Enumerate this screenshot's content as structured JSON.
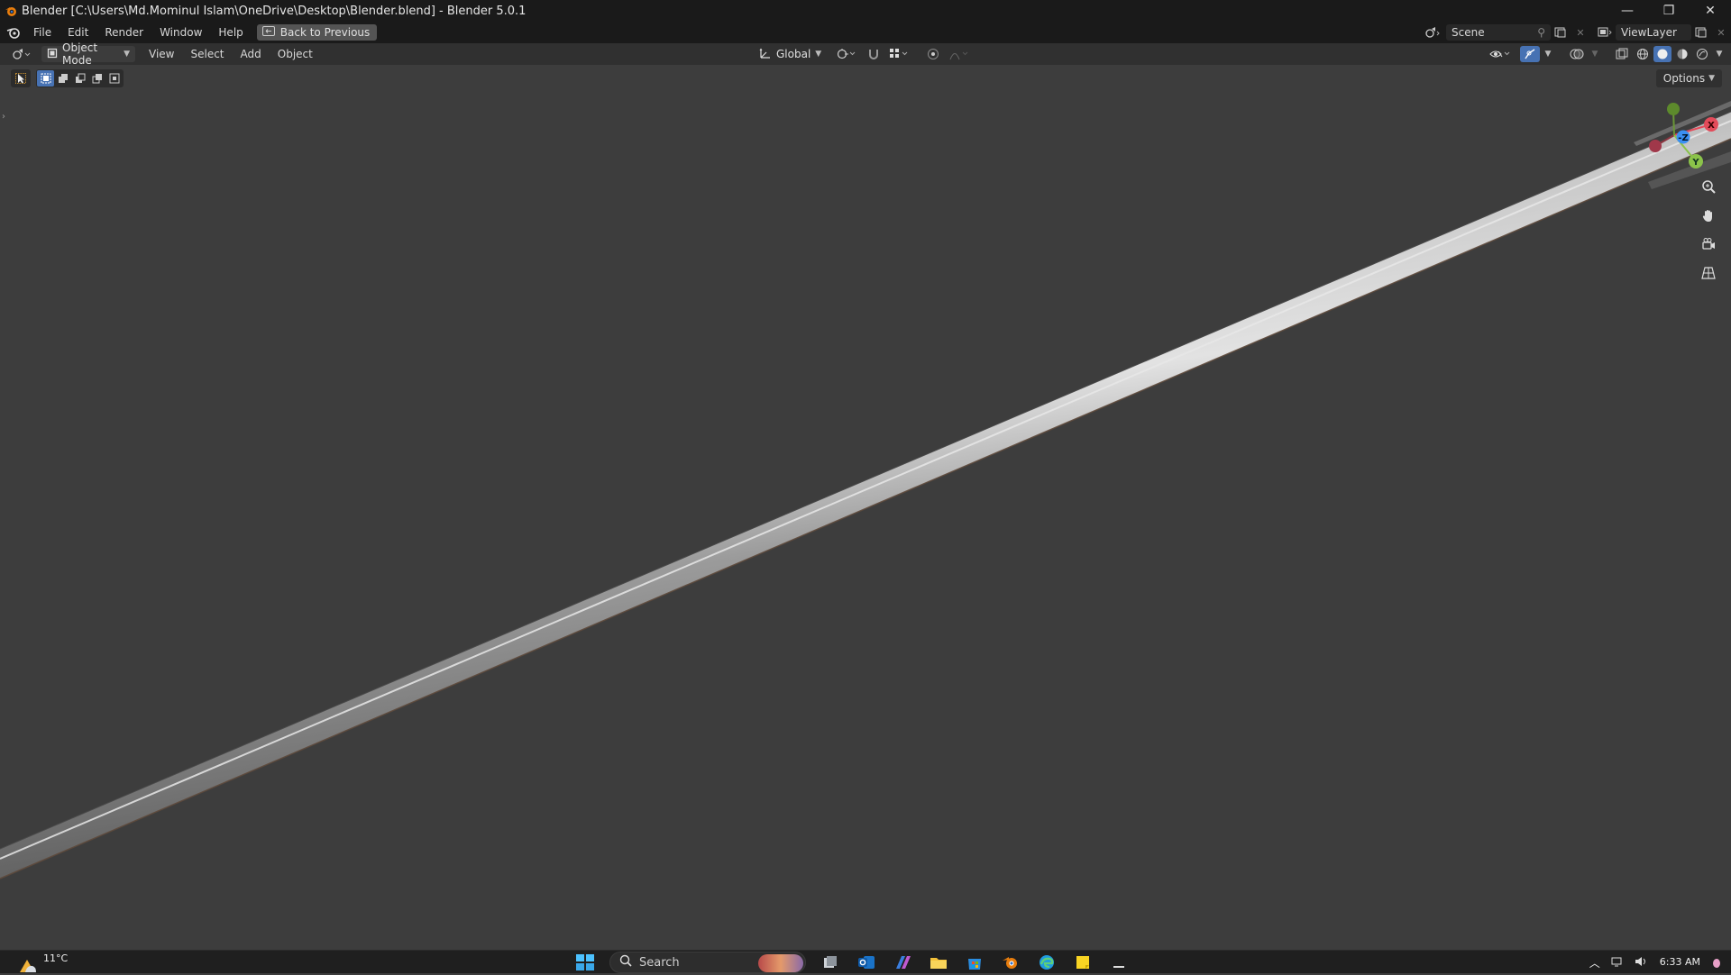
{
  "window": {
    "title": "Blender [C:\\Users\\Md.Mominul Islam\\OneDrive\\Desktop\\Blender.blend] - Blender 5.0.1",
    "controls": [
      "—",
      "❐",
      "✕"
    ]
  },
  "menubar": {
    "items": [
      "File",
      "Edit",
      "Render",
      "Window",
      "Help"
    ],
    "back_button": "Back to Previous",
    "scene": "Scene",
    "view_layer": "ViewLayer"
  },
  "header3d": {
    "mode": "Object Mode",
    "menus": [
      "View",
      "Select",
      "Add",
      "Object"
    ],
    "transform_orientation": "Global",
    "options_label": "Options"
  },
  "viewport": {
    "background_color": "#3d3d3d",
    "object_color": "#9a9a9a"
  },
  "gizmo": {
    "x_label": "X",
    "y_label": "Y",
    "z_label": "Z",
    "x_color": "#e34b5a",
    "y_color": "#8bc34a",
    "z_color": "#3b8ff2"
  },
  "taskbar": {
    "weather": "11°C",
    "search_placeholder": "Search",
    "time": "6:33 AM"
  }
}
